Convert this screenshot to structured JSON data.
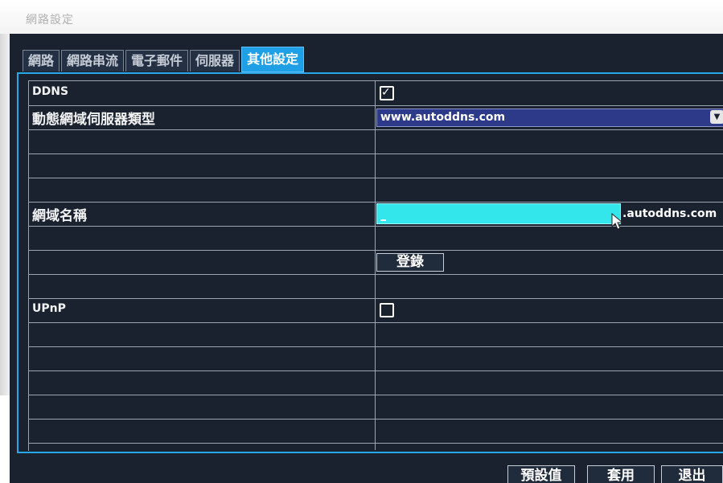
{
  "window": {
    "title": "網路設定"
  },
  "tabs": [
    {
      "label": "網路"
    },
    {
      "label": "網路串流"
    },
    {
      "label": "電子郵件"
    },
    {
      "label": "伺服器"
    },
    {
      "label": "其他設定"
    }
  ],
  "settings": {
    "ddns_label": "DDNS",
    "ddns_checked": true,
    "server_type_label": "動態網域伺服器類型",
    "server_type_value": "www.autoddns.com",
    "domain_label": "網域名稱",
    "domain_value": "",
    "domain_suffix": ".autoddns.com",
    "register_label": "登錄",
    "upnp_label": "UPnP",
    "upnp_checked": false
  },
  "footer": {
    "default_label": "預設值",
    "apply_label": "套用",
    "exit_label": "退出"
  },
  "icons": {
    "checkmark": "✓",
    "dropdown": "chevron-down-icon",
    "cursor": "mouse-pointer-icon"
  },
  "colors": {
    "panel_bg": "#1a2230",
    "active_tab": "#1f9fe6",
    "select_bg": "#2d3a8a",
    "input_highlight": "#33e6ec",
    "frame_accent": "#2aa7e8"
  }
}
